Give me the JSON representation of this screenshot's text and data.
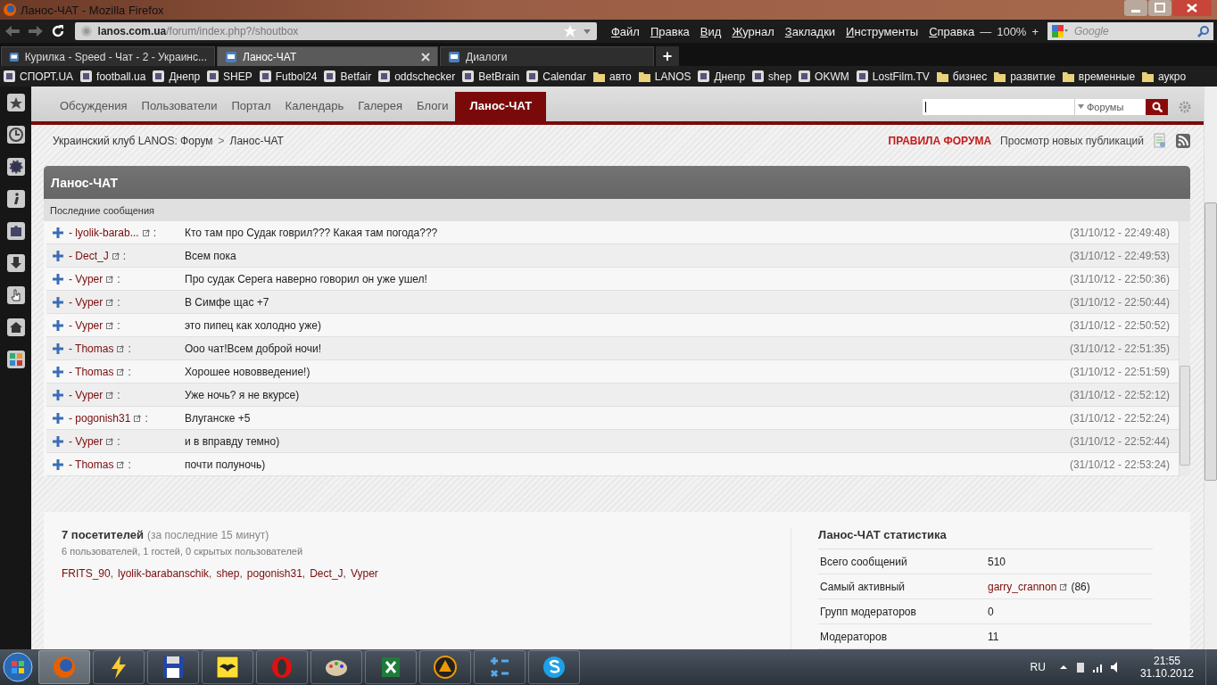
{
  "window": {
    "title": "Ланос-ЧАТ - Mozilla Firefox"
  },
  "address_bar": {
    "domain": "lanos.com.ua",
    "path": "/forum/index.php?/shoutbox"
  },
  "menu": [
    "Файл",
    "Правка",
    "Вид",
    "Журнал",
    "Закладки",
    "Инструменты",
    "Справка"
  ],
  "zoom": {
    "minus": "—",
    "value": "100%",
    "plus": "+"
  },
  "search": {
    "placeholder": "Google"
  },
  "tabs": [
    {
      "label": "Курилка - Speed - Чат - 2 - Украинс...",
      "selected": false
    },
    {
      "label": "Ланос-ЧАТ",
      "selected": true
    },
    {
      "label": "Диалоги",
      "selected": false
    }
  ],
  "new_tab": "+",
  "bookmarks": [
    {
      "label": "СПОРТ.UA",
      "kind": "site"
    },
    {
      "label": "football.ua",
      "kind": "site"
    },
    {
      "label": "Днепр",
      "kind": "site"
    },
    {
      "label": "SHEP",
      "kind": "site"
    },
    {
      "label": "Futbol24",
      "kind": "site"
    },
    {
      "label": "Betfair",
      "kind": "site"
    },
    {
      "label": "oddschecker",
      "kind": "site"
    },
    {
      "label": "BetBrain",
      "kind": "site"
    },
    {
      "label": "Calendar",
      "kind": "site"
    },
    {
      "label": "авто",
      "kind": "folder"
    },
    {
      "label": "LANOS",
      "kind": "folder"
    },
    {
      "label": "Днепр",
      "kind": "site"
    },
    {
      "label": "shep",
      "kind": "site"
    },
    {
      "label": "OKWM",
      "kind": "site"
    },
    {
      "label": "LostFilm.TV",
      "kind": "site"
    },
    {
      "label": "бизнес",
      "kind": "folder"
    },
    {
      "label": "развитие",
      "kind": "folder"
    },
    {
      "label": "временные",
      "kind": "folder"
    },
    {
      "label": "аукро",
      "kind": "folder"
    }
  ],
  "forum_nav": [
    {
      "label": "Обсуждения",
      "selected": false
    },
    {
      "label": "Пользователи",
      "selected": false
    },
    {
      "label": "Портал",
      "selected": false
    },
    {
      "label": "Календарь",
      "selected": false
    },
    {
      "label": "Галерея",
      "selected": false
    },
    {
      "label": "Блоги",
      "selected": false
    },
    {
      "label": "Ланос-ЧАТ",
      "selected": true
    }
  ],
  "forum_search": {
    "scope": "Форумы"
  },
  "breadcrumb": {
    "items": [
      "Украинский клуб LANOS: Форум",
      "Ланос-ЧАТ"
    ],
    "separator": ">"
  },
  "header_links": [
    {
      "label": "ПРАВИЛА ФОРУМА",
      "kind": "rules"
    },
    {
      "label": "Просмотр новых публикаций",
      "kind": "plain"
    }
  ],
  "shoutbox": {
    "title": "Ланос-ЧАТ",
    "subtitle": "Последние сообщения",
    "messages": [
      {
        "user": "- lyolik-barab...",
        "colon": ":",
        "text": "Кто там про Судак говрил??? Какая там погода???",
        "time": "(31/10/12 - 22:49:48)"
      },
      {
        "user": "- Dect_J",
        "colon": ":",
        "text": "Всем пока",
        "time": "(31/10/12 - 22:49:53)"
      },
      {
        "user": "- Vyper",
        "colon": ":",
        "text": "Про судак Серега наверно говорил он уже ушел!",
        "time": "(31/10/12 - 22:50:36)"
      },
      {
        "user": "- Vyper",
        "colon": ":",
        "text": "В Симфе щас +7",
        "time": "(31/10/12 - 22:50:44)"
      },
      {
        "user": "- Vyper",
        "colon": ":",
        "text": "это пипец как холодно уже)",
        "time": "(31/10/12 - 22:50:52)"
      },
      {
        "user": "- Thomas",
        "colon": ":",
        "text": "Ооо чат!Всем доброй ночи!",
        "time": "(31/10/12 - 22:51:35)"
      },
      {
        "user": "- Thomas",
        "colon": ":",
        "text": "Хорошее нововведение!)",
        "time": "(31/10/12 - 22:51:59)"
      },
      {
        "user": "- Vyper",
        "colon": ":",
        "text": "Уже ночь? я не вкурсе)",
        "time": "(31/10/12 - 22:52:12)"
      },
      {
        "user": "- pogonish31",
        "colon": ":",
        "text": "Влуганске +5",
        "time": "(31/10/12 - 22:52:24)"
      },
      {
        "user": "- Vyper",
        "colon": ":",
        "text": "и в вправду темно)",
        "time": "(31/10/12 - 22:52:44)"
      },
      {
        "user": "- Thomas",
        "colon": ":",
        "text": "почти полуночь)",
        "time": "(31/10/12 - 22:53:24)"
      }
    ]
  },
  "online": {
    "title": "7 посетителей",
    "period": "(за последние 15 минут)",
    "summary": "6 пользователей, 1 гостей, 0 скрытых пользователей",
    "users": [
      {
        "name": "FRITS_90",
        "comma": ","
      },
      {
        "name": "lyolik-barabanschik",
        "comma": ","
      },
      {
        "name": "shep",
        "comma": ","
      },
      {
        "name": "pogonish31",
        "comma": ","
      },
      {
        "name": "Dect_J",
        "comma": ","
      },
      {
        "name": "Vyper"
      }
    ]
  },
  "stats": {
    "title": "Ланос-ЧАТ статистика",
    "rows": [
      {
        "label": "Всего сообщений",
        "value": "510",
        "kind": "plain"
      },
      {
        "label": "Самый активный",
        "value": "garry_crannon",
        "extra": "(86)",
        "kind": "user"
      },
      {
        "label": "Групп модераторов",
        "value": "0",
        "kind": "plain"
      },
      {
        "label": "Модераторов",
        "value": "11",
        "kind": "plain"
      }
    ]
  },
  "taskbar": {
    "language": "RU",
    "time": "21:55",
    "date": "31.10.2012"
  }
}
